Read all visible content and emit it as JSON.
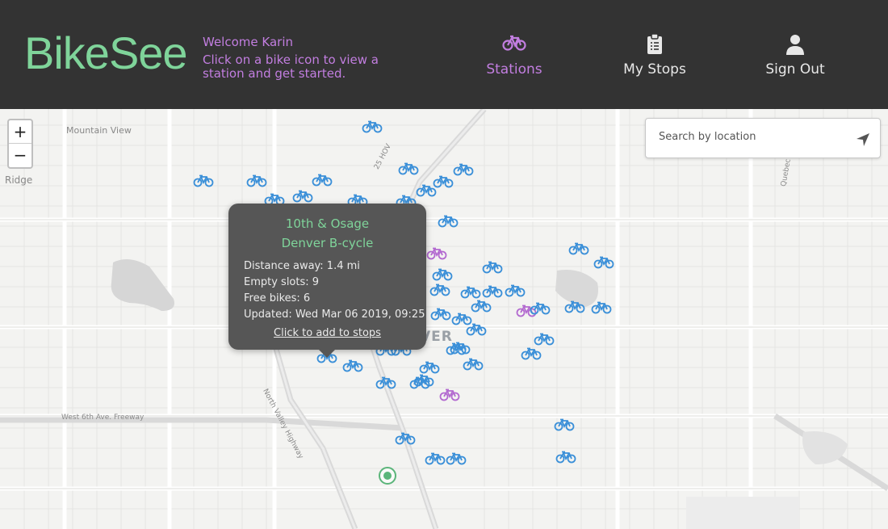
{
  "header": {
    "logo": "BikeSee",
    "welcome": "Welcome Karin",
    "message": "Click on a bike icon to view a station and get started.",
    "nav": [
      {
        "label": "Stations",
        "icon": "bike-icon",
        "active": true
      },
      {
        "label": "My Stops",
        "icon": "clipboard-icon",
        "active": false
      },
      {
        "label": "Sign Out",
        "icon": "user-icon",
        "active": false
      }
    ]
  },
  "map": {
    "labels": {
      "mountain_view": "Mountain View",
      "ridge": "Ridge",
      "denver": "VER",
      "freeway": "West 6th Ave. Freeway",
      "valley_hwy": "North Valley Highway",
      "hov": "25 HOV",
      "quebec": "Quebec"
    },
    "zoom_in": "+",
    "zoom_out": "−",
    "search": {
      "placeholder": "Search by location",
      "icon": "location-arrow-icon"
    }
  },
  "popup": {
    "title": "10th & Osage",
    "network": "Denver B-cycle",
    "distance": "Distance away: 1.4 mi",
    "empty_slots": "Empty slots: 9",
    "free_bikes": "Free bikes: 6",
    "updated": "Updated: Wed Mar 06 2019, 09:25",
    "link": "Click to add to stops"
  },
  "colors": {
    "header_bg": "#333333",
    "logo": "#7fd49a",
    "accent_purple": "#c27ee0",
    "bike_blue": "#3a8fd8",
    "bike_purple": "#b36ad0",
    "popup_bg": "#565656",
    "marker_green": "#5bb57a"
  }
}
